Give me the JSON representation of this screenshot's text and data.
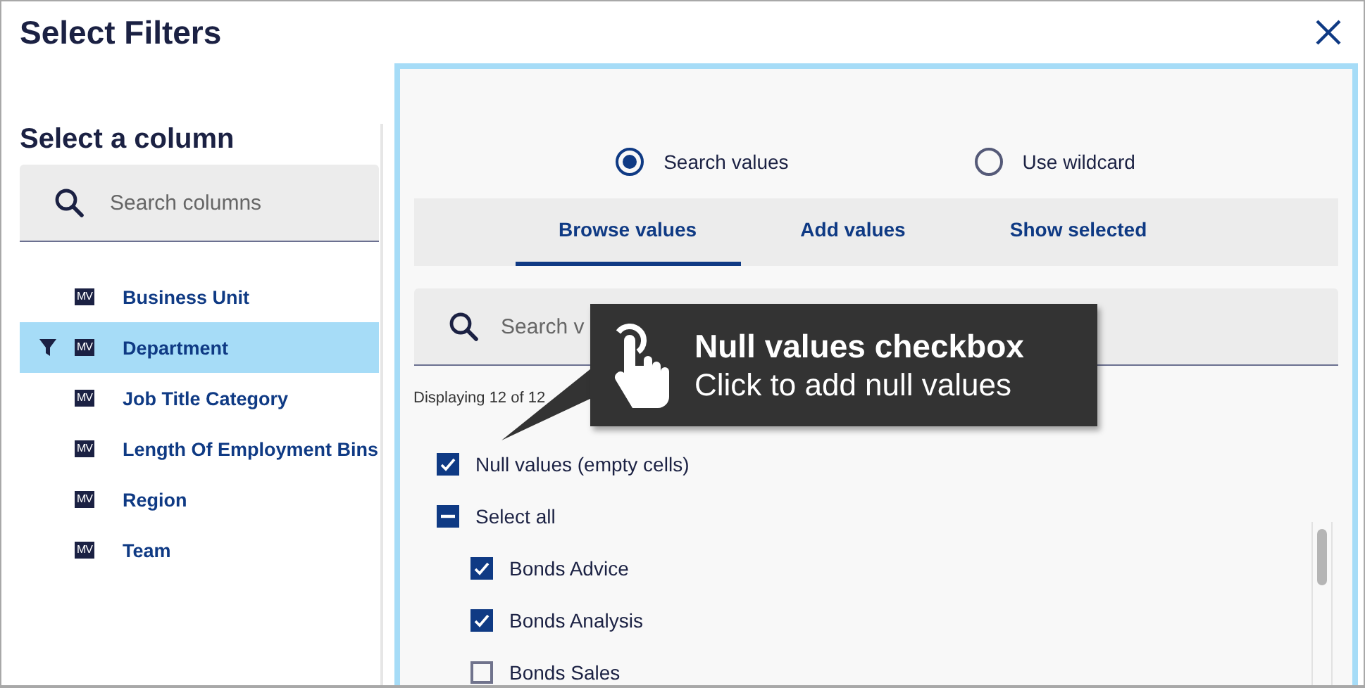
{
  "dialog": {
    "title": "Select Filters"
  },
  "column_panel": {
    "heading": "Select a column",
    "search": {
      "placeholder": "Search columns"
    },
    "columns": [
      {
        "label": "Business Unit",
        "badge": "MV",
        "selected": false,
        "filtered": false
      },
      {
        "label": "Department",
        "badge": "MV",
        "selected": true,
        "filtered": true
      },
      {
        "label": "Job Title Category",
        "badge": "MV",
        "selected": false,
        "filtered": false
      },
      {
        "label": "Length Of Employment Bins",
        "badge": "MV",
        "selected": false,
        "filtered": false
      },
      {
        "label": "Region",
        "badge": "MV",
        "selected": false,
        "filtered": false
      },
      {
        "label": "Team",
        "badge": "MV",
        "selected": false,
        "filtered": false
      }
    ]
  },
  "value_panel": {
    "modes": [
      {
        "label": "Search values",
        "selected": true
      },
      {
        "label": "Use wildcard",
        "selected": false
      }
    ],
    "tabs": [
      {
        "label": "Browse values",
        "selected": true
      },
      {
        "label": "Add values",
        "selected": false
      },
      {
        "label": "Show selected",
        "selected": false
      }
    ],
    "search": {
      "placeholder": "Search v"
    },
    "count_text": "Displaying 12 of 12",
    "null_option": {
      "label": "Null values (empty cells)",
      "checked": true
    },
    "select_all": {
      "label": "Select all",
      "partial": true
    },
    "values": [
      {
        "label": "Bonds Advice",
        "checked": true
      },
      {
        "label": "Bonds Analysis",
        "checked": true
      },
      {
        "label": "Bonds Sales",
        "checked": false
      }
    ]
  },
  "tooltip": {
    "title": "Null values checkbox",
    "text": "Click to add null values"
  }
}
